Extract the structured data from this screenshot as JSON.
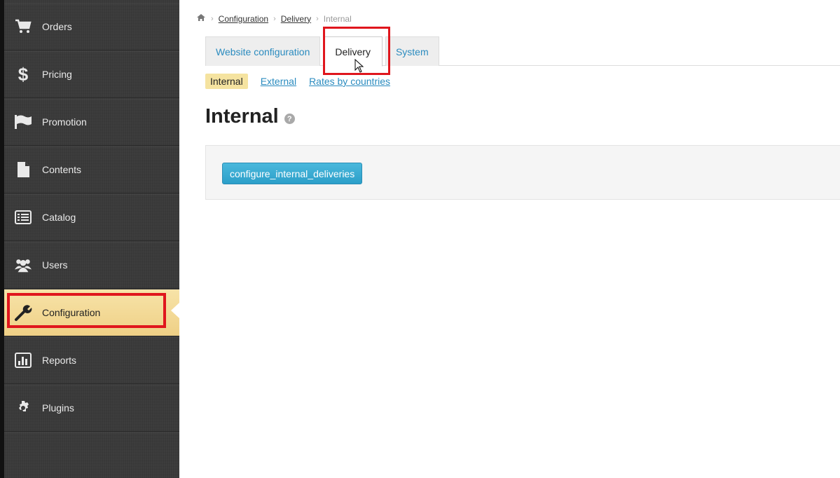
{
  "sidebar": {
    "items": [
      {
        "label": "Orders",
        "icon": "cart-icon"
      },
      {
        "label": "Pricing",
        "icon": "dollar-icon"
      },
      {
        "label": "Promotion",
        "icon": "flag-icon"
      },
      {
        "label": "Contents",
        "icon": "file-icon"
      },
      {
        "label": "Catalog",
        "icon": "list-icon"
      },
      {
        "label": "Users",
        "icon": "users-icon"
      },
      {
        "label": "Configuration",
        "icon": "wrench-icon",
        "active": true
      },
      {
        "label": "Reports",
        "icon": "chart-icon"
      },
      {
        "label": "Plugins",
        "icon": "gear-icon"
      }
    ]
  },
  "breadcrumb": {
    "home_icon": "home-icon",
    "items": [
      "Configuration",
      "Delivery",
      "Internal"
    ]
  },
  "tabs": {
    "items": [
      "Website configuration",
      "Delivery",
      "System"
    ],
    "active": "Delivery"
  },
  "subtabs": {
    "items": [
      "Internal",
      "External",
      "Rates by countries"
    ],
    "active": "Internal"
  },
  "page": {
    "title": "Internal",
    "help_icon": "help-icon"
  },
  "panel": {
    "button_label": "configure_internal_deliveries"
  },
  "colors": {
    "highlight_red": "#e0161d",
    "active_yellow": "#f5dd9a",
    "link_blue": "#2a8bbf",
    "button_blue": "#2c9fc9"
  }
}
